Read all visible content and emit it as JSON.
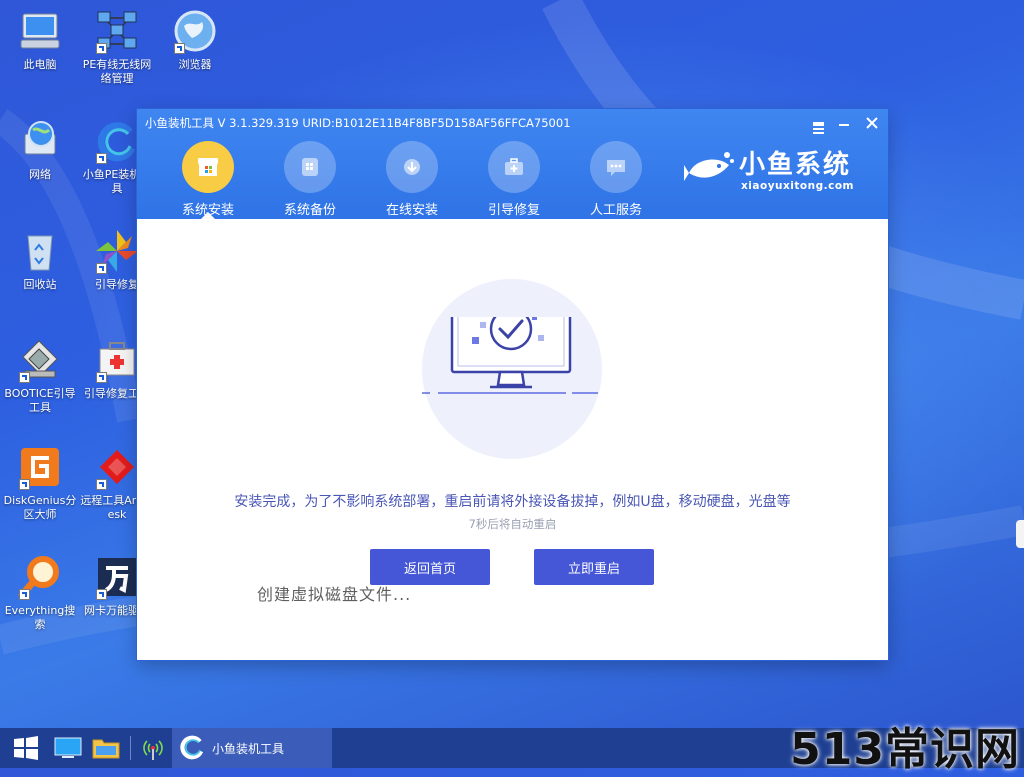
{
  "desktop": {
    "icons": [
      {
        "label": "此电脑"
      },
      {
        "label": "PE有线无线网络管理"
      },
      {
        "label": "浏览器"
      },
      {
        "label": "网络"
      },
      {
        "label": "小鱼PE装机工具"
      },
      {
        "label": "回收站"
      },
      {
        "label": "引导修复"
      },
      {
        "label": "BOOTICE引导工具"
      },
      {
        "label": "引导修复工具"
      },
      {
        "label": "DiskGenius分区大师"
      },
      {
        "label": "远程工具AnyDesk"
      },
      {
        "label": "Everything搜索"
      },
      {
        "label": "网卡万能驱动"
      }
    ]
  },
  "window": {
    "title": "小鱼装机工具 V 3.1.329.319 URID:B1012E11B4F8BF5D158AF56FFCA75001",
    "nav": [
      {
        "label": "系统安装",
        "icon": "system-install-icon",
        "active": true
      },
      {
        "label": "系统备份",
        "icon": "backup-icon",
        "active": false
      },
      {
        "label": "在线安装",
        "icon": "download-icon",
        "active": false
      },
      {
        "label": "引导修复",
        "icon": "toolbox-icon",
        "active": false
      },
      {
        "label": "人工服务",
        "icon": "chat-icon",
        "active": false
      }
    ],
    "brand": {
      "name": "小鱼系统",
      "url": "xiaoyuxitong.com"
    },
    "message": "安装完成，为了不影响系统部署，重启前请将外接设备拔掉，例如U盘，移动硬盘，光盘等",
    "countdown": "7秒后将自动重启",
    "buttons": {
      "home": "返回首页",
      "restart": "立即重启"
    },
    "ghost_text": "创建虚拟磁盘文件..."
  },
  "taskbar": {
    "app_label": "小鱼装机工具"
  },
  "watermark": "513常识网",
  "colors": {
    "accent": "#4557d6",
    "header": "#3478ec",
    "active_nav": "#f8cc44",
    "message": "#4a57b7"
  }
}
